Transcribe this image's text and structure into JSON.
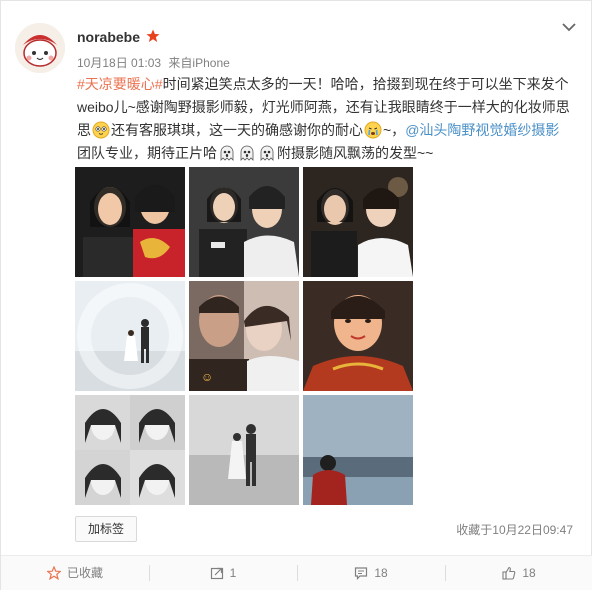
{
  "post": {
    "username": "norabebe",
    "timestamp": "10月18日 01:03",
    "source_prefix": "来自",
    "source": "iPhone",
    "vip_icon": "red-star-icon",
    "more_icon": "chevron-down-icon",
    "text": {
      "topic": "#天凉要暖心#",
      "seg1": "时间紧迫笑点太多的一天！哈哈，拾掇到现在终于可以坐下来发个weibo儿~感谢陶野摄影师毅，灯光师阿燕，还有让我眼睛终于一样大的化妆师思思",
      "emoji1": "cute-face-emoji",
      "seg2": "还有客服琪琪，这一天的确感谢你的耐心",
      "emoji2": "crying-face-emoji",
      "seg3": "~，",
      "mention": "@汕头陶野视觉婚纱摄影",
      "seg4": "团队专业，期待正片哈",
      "emoji3": "ghost-emoji",
      "seg5": "附摄影随风飘荡的发型~~"
    },
    "photos": [
      {
        "name": "photo-selfie-red-dress",
        "palette": [
          "#1d1d1d",
          "#c8222a",
          "#f1c9a8"
        ]
      },
      {
        "name": "photo-selfie-bride-white",
        "palette": [
          "#3b3b3b",
          "#eeeeee",
          "#efd1b8"
        ]
      },
      {
        "name": "photo-selfie-bride-flowers",
        "palette": [
          "#2d2620",
          "#f5f5f5",
          "#e9c8ad"
        ]
      },
      {
        "name": "photo-couple-beach-light",
        "palette": [
          "#e9eef2",
          "#c9d4dc",
          "#2c2c2c"
        ]
      },
      {
        "name": "photo-couple-closeup",
        "palette": [
          "#7b6a62",
          "#e9d1c3",
          "#31251f"
        ]
      },
      {
        "name": "photo-bride-red-dress-portrait",
        "palette": [
          "#b33a1f",
          "#f0b58d",
          "#2a1d18"
        ]
      },
      {
        "name": "photo-bw-grid",
        "palette": [
          "#2b2b2b",
          "#d9d9d9",
          "#7a7a7a"
        ]
      },
      {
        "name": "photo-couple-beach-bw",
        "palette": [
          "#9c9c9c",
          "#d8d8d8",
          "#303030"
        ]
      },
      {
        "name": "photo-sea-view",
        "palette": [
          "#8aa0b3",
          "#5a6c7b",
          "#a3241e"
        ]
      }
    ],
    "tag_button": "加标签",
    "fav_time": "收藏于10月22日09:47"
  },
  "actions": [
    {
      "name": "favorited",
      "icon": "star-icon",
      "label": "已收藏"
    },
    {
      "name": "repost",
      "icon": "repost-icon",
      "label": "1"
    },
    {
      "name": "comment",
      "icon": "comment-icon",
      "label": "18"
    },
    {
      "name": "like",
      "icon": "thumbs-up-icon",
      "label": "18"
    }
  ],
  "colors": {
    "link": "#eb7350",
    "mention": "#4a90c8",
    "meta": "#808080"
  }
}
